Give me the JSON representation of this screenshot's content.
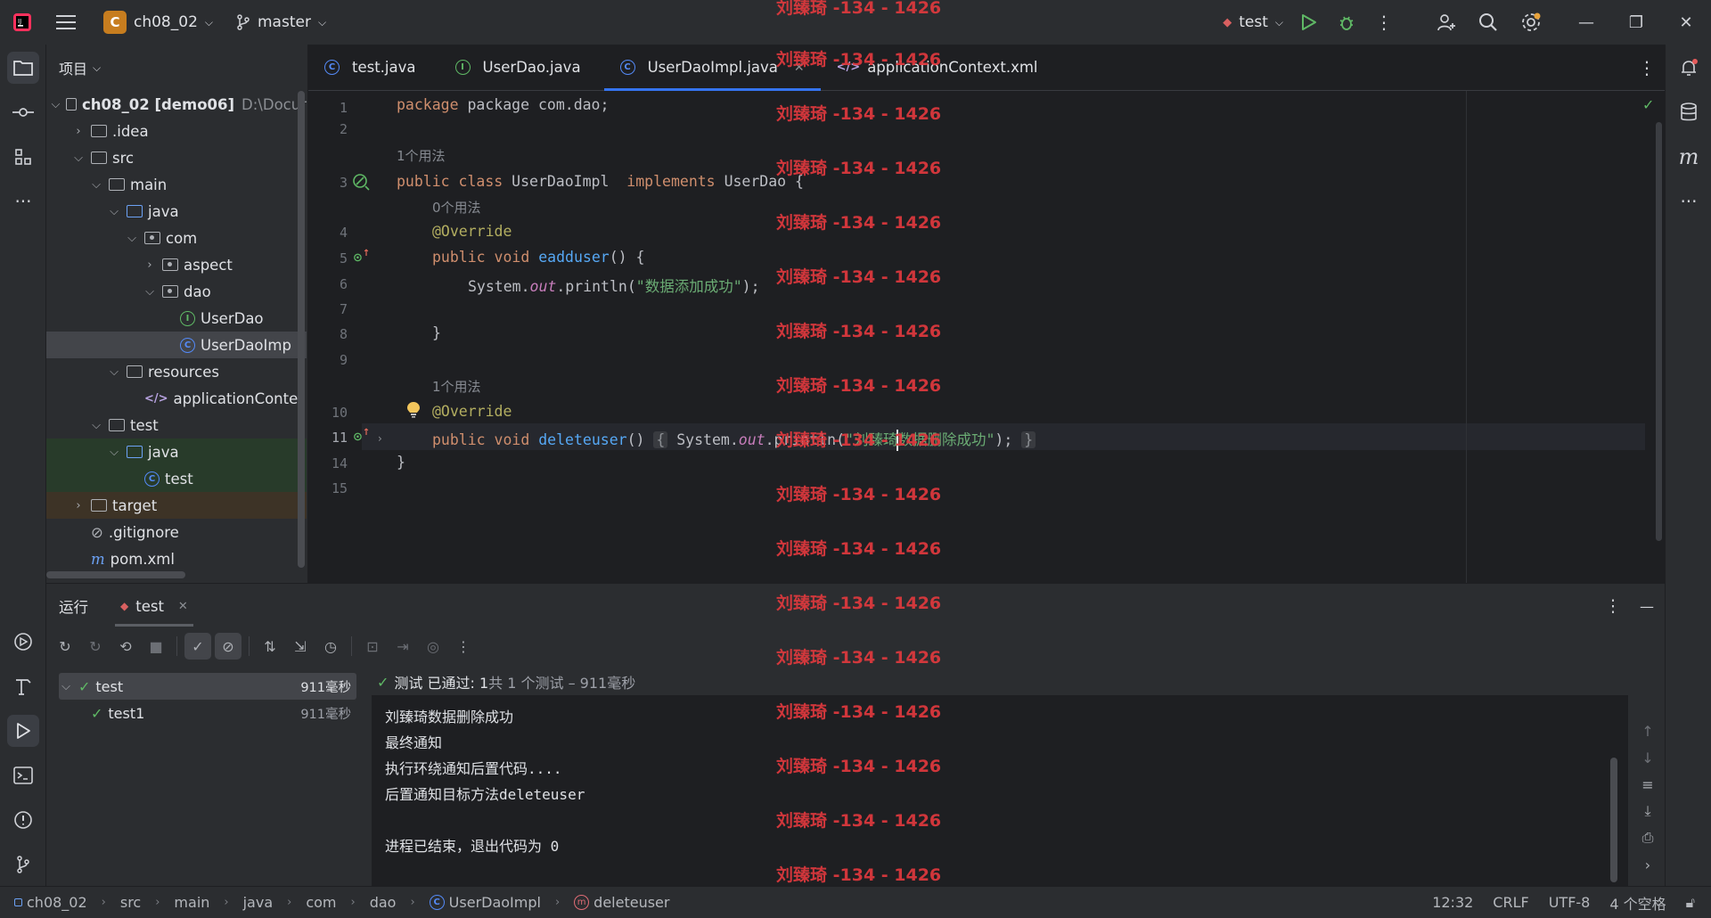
{
  "titlebar": {
    "project_badge": "C",
    "project_name": "ch08_02",
    "branch": "master",
    "run_config": "test"
  },
  "project_panel": {
    "title": "项目",
    "tree": [
      {
        "label": "ch08_02 [demo06]",
        "suffix": "D:\\Docur",
        "depth": 0,
        "type": "module",
        "expanded": true
      },
      {
        "label": ".idea",
        "depth": 1,
        "type": "folder",
        "expanded": false
      },
      {
        "label": "src",
        "depth": 1,
        "type": "folder",
        "expanded": true
      },
      {
        "label": "main",
        "depth": 2,
        "type": "folder",
        "expanded": true
      },
      {
        "label": "java",
        "depth": 3,
        "type": "folder-blue",
        "expanded": true
      },
      {
        "label": "com",
        "depth": 4,
        "type": "package",
        "expanded": true
      },
      {
        "label": "aspect",
        "depth": 5,
        "type": "package",
        "expanded": false
      },
      {
        "label": "dao",
        "depth": 5,
        "type": "package",
        "expanded": true
      },
      {
        "label": "UserDao",
        "depth": 6,
        "type": "interface"
      },
      {
        "label": "UserDaoImp",
        "depth": 6,
        "type": "class",
        "selected": true
      },
      {
        "label": "resources",
        "depth": 3,
        "type": "folder",
        "expanded": true
      },
      {
        "label": "applicationConte",
        "depth": 4,
        "type": "xml"
      },
      {
        "label": "test",
        "depth": 2,
        "type": "folder",
        "expanded": true
      },
      {
        "label": "java",
        "depth": 3,
        "type": "folder-blue",
        "expanded": true,
        "highlight": "green"
      },
      {
        "label": "test",
        "depth": 4,
        "type": "class",
        "highlight": "green"
      },
      {
        "label": "target",
        "depth": 1,
        "type": "folder",
        "expanded": false,
        "highlight": "orange"
      },
      {
        "label": ".gitignore",
        "depth": 1,
        "type": "ignore"
      },
      {
        "label": "pom.xml",
        "depth": 1,
        "type": "maven"
      }
    ]
  },
  "editor": {
    "tabs": [
      {
        "label": "test.java",
        "icon": "class-icon"
      },
      {
        "label": "UserDao.java",
        "icon": "interface-icon"
      },
      {
        "label": "UserDaoImpl.java",
        "icon": "class-icon",
        "active": true
      },
      {
        "label": "applicationContext.xml",
        "icon": "xml-icon"
      }
    ],
    "usage_hints": [
      "1个用法",
      "0个用法",
      "1个用法"
    ],
    "lines": {
      "l1": "package com.dao;",
      "l3_kw": "public class ",
      "l3_name": "UserDaoImpl  ",
      "l3_impl": "implements ",
      "l3_rest": "UserDao {",
      "l4": "@Override",
      "l5_kw": "public void ",
      "l5_fn": "eadduser",
      "l5_rest": "() {",
      "l6_a": "System.",
      "l6_out": "out",
      "l6_b": ".println(",
      "l6_str": "\"数据添加成功\"",
      "l6_c": ");",
      "l8": "}",
      "l10": "@Override",
      "l11_kw": "public void ",
      "l11_fn": "deleteuser",
      "l11_a": "() ",
      "l11_fold_open": "{",
      "l11_b": " System.",
      "l11_out": "out",
      "l11_c": ".println(",
      "l11_str": "\"刘臻琦数据删除成功\"",
      "l11_d": "); ",
      "l11_fold_close": "}",
      "l14": "}"
    },
    "line_numbers": [
      "1",
      "2",
      "3",
      "4",
      "5",
      "6",
      "7",
      "8",
      "9",
      "10",
      "11",
      "14",
      "15"
    ]
  },
  "run_panel": {
    "title": "运行",
    "tab": "test",
    "status_prefix": "测试 已通过: 1",
    "status_suffix": "共 1 个测试 – 911毫秒",
    "tests": [
      {
        "name": "test",
        "time": "911毫秒"
      },
      {
        "name": "test1",
        "time": "911毫秒"
      }
    ],
    "console": [
      "刘臻琦数据删除成功",
      "最终通知",
      "执行环绕通知后置代码....",
      "后置通知目标方法deleteuser",
      "",
      "进程已结束，退出代码为 0"
    ]
  },
  "statusbar": {
    "crumbs": [
      "ch08_02",
      "src",
      "main",
      "java",
      "com",
      "dao",
      "UserDaoImpl",
      "deleteuser"
    ],
    "position": "12:32",
    "line_sep": "CRLF",
    "encoding": "UTF-8",
    "indent": "4 个空格"
  },
  "watermark": "刘臻琦 -134 - 1426",
  "colors": {
    "accent": "#3574f0",
    "success": "#5fb865",
    "watermark": "#e0393e"
  }
}
